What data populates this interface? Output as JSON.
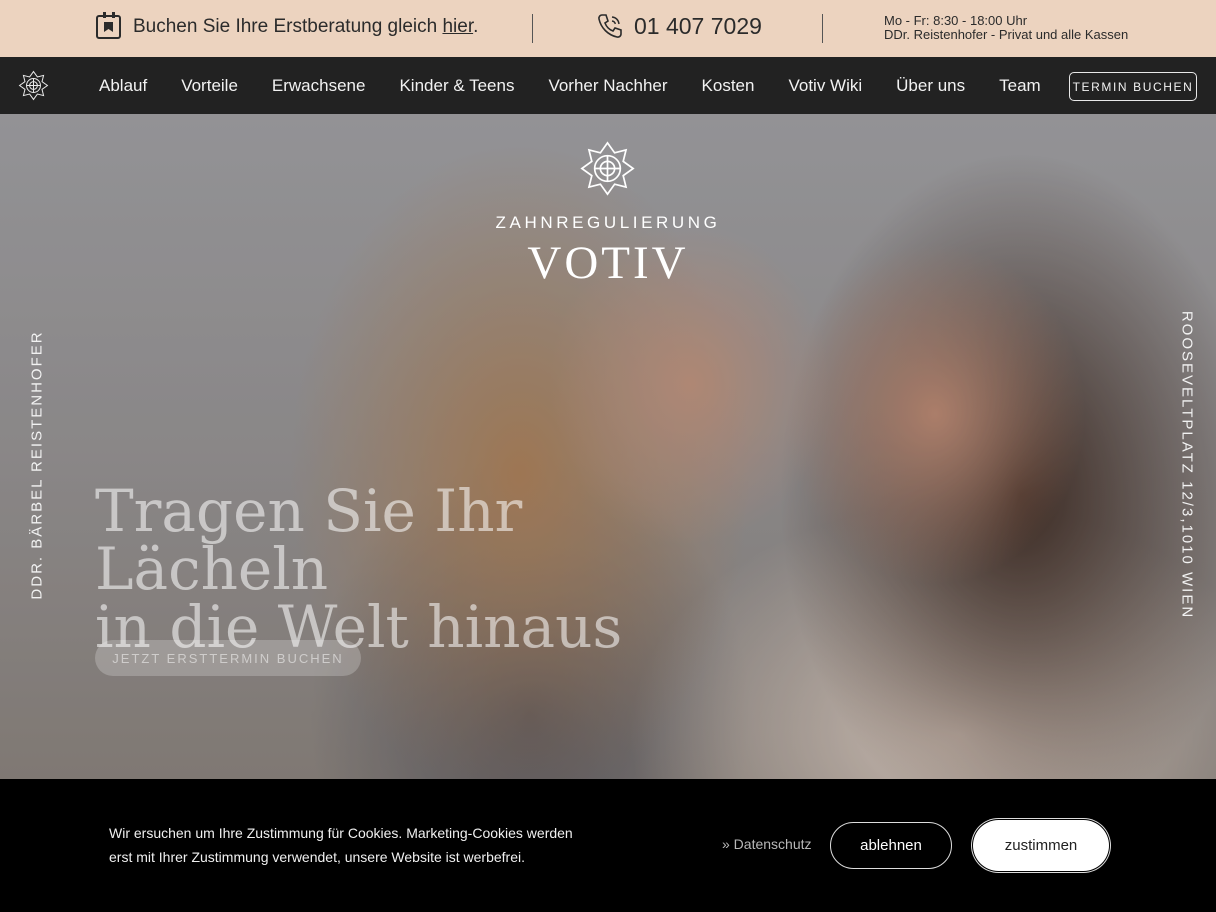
{
  "topbar": {
    "booking_text": "Buchen Sie Ihre Erstberatung gleich",
    "booking_link": "hier",
    "booking_period": ".",
    "phone": "01 407 7029",
    "hours": "Mo - Fr: 8:30 - 18:00 Uhr",
    "practice": "DDr. Reistenhofer - Privat und alle Kassen"
  },
  "nav": {
    "items": [
      {
        "label": "Ablauf"
      },
      {
        "label": "Vorteile"
      },
      {
        "label": "Erwachsene"
      },
      {
        "label": "Kinder & Teens"
      },
      {
        "label": "Vorher Nachher"
      },
      {
        "label": "Kosten"
      },
      {
        "label": "Votiv Wiki"
      },
      {
        "label": "Über uns"
      },
      {
        "label": "Team"
      }
    ],
    "cta_label": "TERMIN BUCHEN"
  },
  "hero": {
    "brand_sub": "ZAHNREGULIERUNG",
    "brand_name": "VOTIV",
    "headline_line1": "Tragen Sie Ihr Lächeln",
    "headline_line2": "in die Welt hinaus",
    "cta_label": "JETZT ERSTTERMIN BUCHEN",
    "side_left": "DDR. BÄRBEL REISTENHOFER",
    "side_right": "ROOSEVELTPLATZ 12/3,1010 WIEN"
  },
  "cookie": {
    "text": "Wir ersuchen um Ihre Zustimmung für Cookies. Marketing-Cookies werden erst mit Ihrer Zustimmung verwendet, unsere Website ist werbefrei.",
    "privacy_link": "» Datenschutz",
    "decline_label": "ablehnen",
    "accept_label": "zustimmen"
  },
  "colors": {
    "topbar_bg": "#ecd3bf",
    "nav_bg": "#222222",
    "cookie_bg": "#000000"
  },
  "icons": [
    "calendar-icon",
    "phone-icon",
    "logo-emblem-icon"
  ]
}
